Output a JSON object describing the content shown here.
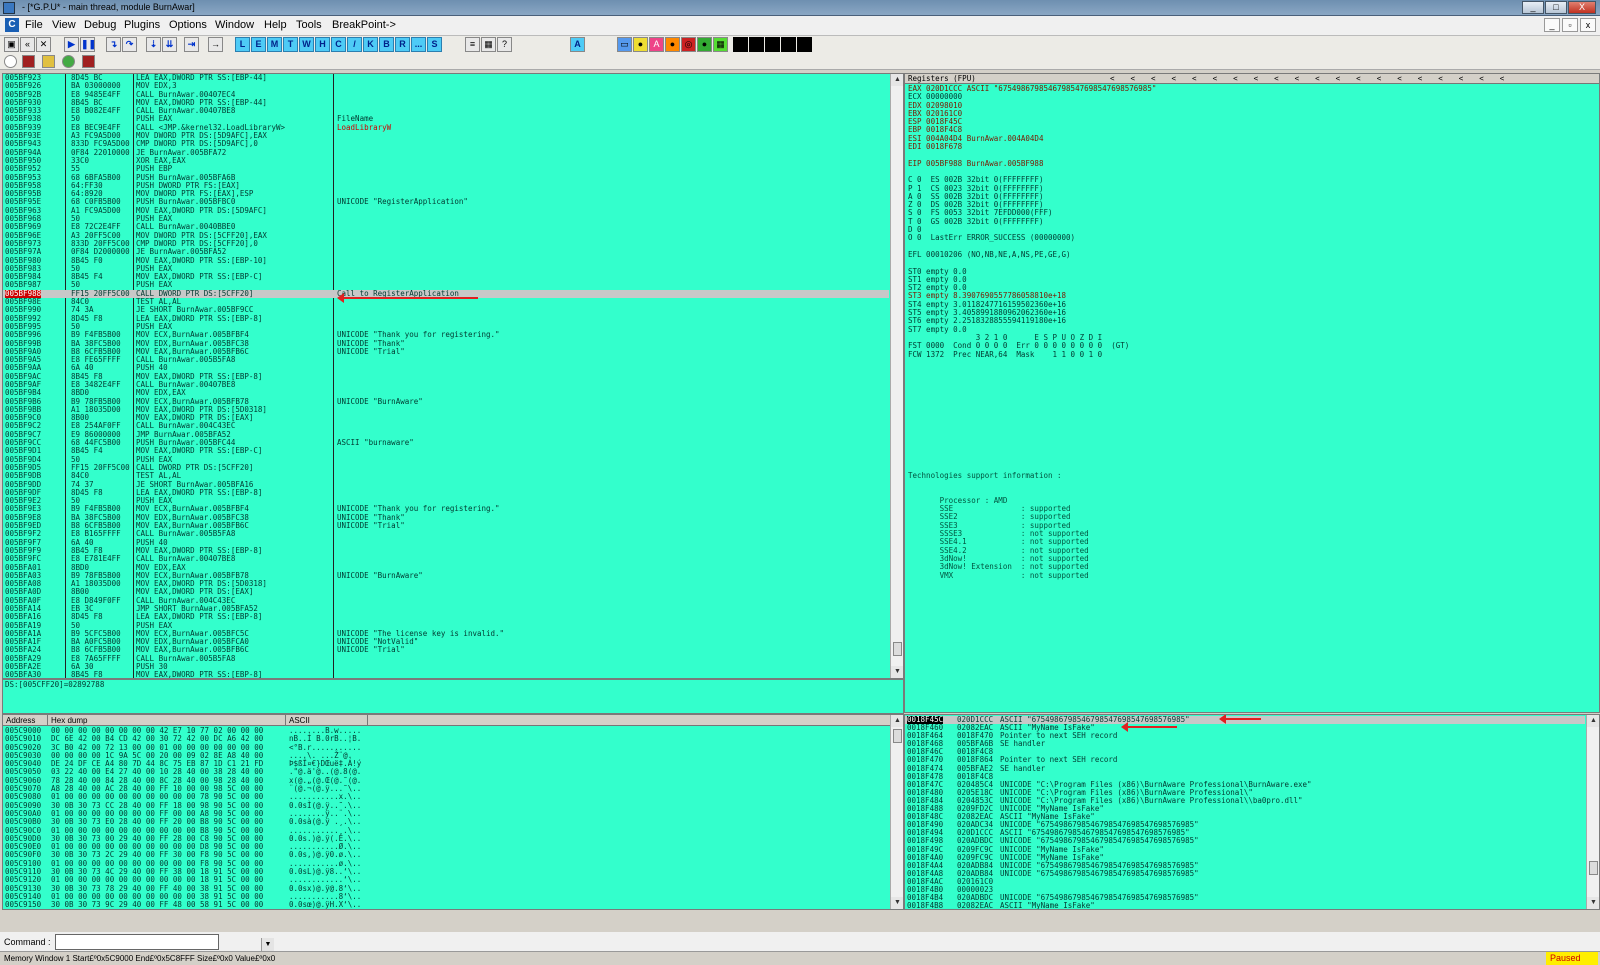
{
  "window": {
    "title": "- [*G.P.U* - main thread, module BurnAwar]",
    "controls": [
      "_",
      "□",
      "X"
    ]
  },
  "menu": {
    "items": [
      "File",
      "View",
      "Debug",
      "Plugins",
      "Options",
      "Window",
      "Help",
      "Tools",
      "BreakPoint->"
    ]
  },
  "toolbar": {
    "letters": [
      "L",
      "E",
      "M",
      "T",
      "W",
      "H",
      "C",
      "/",
      "K",
      "B",
      "R",
      "...",
      "S"
    ]
  },
  "cpu": {
    "rows": [
      {
        "addr": "005BF923",
        "hex": "8D45 BC",
        "asm": "LEA EAX,DWORD PTR SS:[EBP-44]",
        "cmt": ""
      },
      {
        "addr": "005BF926",
        "hex": "BA 03000000",
        "asm": "MOV EDX,3",
        "cmt": ""
      },
      {
        "addr": "005BF92B",
        "hex": "E8 9485E4FF",
        "asm": "CALL BurnAwar.00407EC4",
        "cmt": ""
      },
      {
        "addr": "005BF930",
        "hex": "8B45 BC",
        "asm": "MOV EAX,DWORD PTR SS:[EBP-44]",
        "cmt": ""
      },
      {
        "addr": "005BF933",
        "hex": "E8 B082E4FF",
        "asm": "CALL BurnAwar.00407BE8",
        "cmt": ""
      },
      {
        "addr": "005BF938",
        "hex": "50",
        "asm": "PUSH EAX",
        "cmt": "FileName"
      },
      {
        "addr": "005BF939",
        "hex": "E8 BEC9E4FF",
        "asm": "CALL <JMP.&kernel32.LoadLibraryW>",
        "cmt": "LoadLibraryW"
      },
      {
        "addr": "005BF93E",
        "hex": "A3 FC9A5D00",
        "asm": "MOV DWORD PTR DS:[5D9AFC],EAX",
        "cmt": ""
      },
      {
        "addr": "005BF943",
        "hex": "833D FC9A5D00",
        "asm": "CMP DWORD PTR DS:[5D9AFC],0",
        "cmt": ""
      },
      {
        "addr": "005BF94A",
        "hex": "0F84 22010000",
        "asm": "JE BurnAwar.005BFA72",
        "cmt": ""
      },
      {
        "addr": "005BF950",
        "hex": "33C0",
        "asm": "XOR EAX,EAX",
        "cmt": ""
      },
      {
        "addr": "005BF952",
        "hex": "55",
        "asm": "PUSH EBP",
        "cmt": ""
      },
      {
        "addr": "005BF953",
        "hex": "68 6BFA5B00",
        "asm": "PUSH BurnAwar.005BFA6B",
        "cmt": ""
      },
      {
        "addr": "005BF958",
        "hex": "64:FF30",
        "asm": "PUSH DWORD PTR FS:[EAX]",
        "cmt": ""
      },
      {
        "addr": "005BF95B",
        "hex": "64:8920",
        "asm": "MOV DWORD PTR FS:[EAX],ESP",
        "cmt": ""
      },
      {
        "addr": "005BF95E",
        "hex": "68 C0FB5B00",
        "asm": "PUSH BurnAwar.005BFBC0",
        "cmt": "UNICODE \"RegisterApplication\""
      },
      {
        "addr": "005BF963",
        "hex": "A1 FC9A5D00",
        "asm": "MOV EAX,DWORD PTR DS:[5D9AFC]",
        "cmt": ""
      },
      {
        "addr": "005BF968",
        "hex": "50",
        "asm": "PUSH EAX",
        "cmt": ""
      },
      {
        "addr": "005BF969",
        "hex": "E8 72C2E4FF",
        "asm": "CALL BurnAwar.0040BBE0",
        "cmt": ""
      },
      {
        "addr": "005BF96E",
        "hex": "A3 20FF5C00",
        "asm": "MOV DWORD PTR DS:[5CFF20],EAX",
        "cmt": ""
      },
      {
        "addr": "005BF973",
        "hex": "833D 20FF5C00",
        "asm": "CMP DWORD PTR DS:[5CFF20],0",
        "cmt": ""
      },
      {
        "addr": "005BF97A",
        "hex": "0F84 D2000000",
        "asm": "JE BurnAwar.005BFA52",
        "cmt": ""
      },
      {
        "addr": "005BF980",
        "hex": "8B45 F0",
        "asm": "MOV EAX,DWORD PTR SS:[EBP-10]",
        "cmt": ""
      },
      {
        "addr": "005BF983",
        "hex": "50",
        "asm": "PUSH EAX",
        "cmt": ""
      },
      {
        "addr": "005BF984",
        "hex": "8B45 F4",
        "asm": "MOV EAX,DWORD PTR SS:[EBP-C]",
        "cmt": ""
      },
      {
        "addr": "005BF987",
        "hex": "50",
        "asm": "PUSH EAX",
        "cmt": ""
      },
      {
        "addr": "005BF988",
        "hex": "FF15 20FF5C00",
        "asm": "CALL DWORD PTR DS:[5CFF20]",
        "cmt": "Call to RegisterApplication"
      },
      {
        "addr": "005BF98E",
        "hex": "84C0",
        "asm": "TEST AL,AL",
        "cmt": ""
      },
      {
        "addr": "005BF990",
        "hex": "74 3A",
        "asm": "JE SHORT BurnAwar.005BF9CC",
        "cmt": ""
      },
      {
        "addr": "005BF992",
        "hex": "8D45 F8",
        "asm": "LEA EAX,DWORD PTR SS:[EBP-8]",
        "cmt": ""
      },
      {
        "addr": "005BF995",
        "hex": "50",
        "asm": "PUSH EAX",
        "cmt": ""
      },
      {
        "addr": "005BF996",
        "hex": "B9 F4FB5B00",
        "asm": "MOV ECX,BurnAwar.005BFBF4",
        "cmt": "UNICODE \"Thank you for registering.\""
      },
      {
        "addr": "005BF99B",
        "hex": "BA 38FC5B00",
        "asm": "MOV EDX,BurnAwar.005BFC38",
        "cmt": "UNICODE \"Thank\""
      },
      {
        "addr": "005BF9A0",
        "hex": "B8 6CFB5B00",
        "asm": "MOV EAX,BurnAwar.005BFB6C",
        "cmt": "UNICODE \"Trial\""
      },
      {
        "addr": "005BF9A5",
        "hex": "E8 FE65FFFF",
        "asm": "CALL BurnAwar.005B5FA8",
        "cmt": ""
      },
      {
        "addr": "005BF9AA",
        "hex": "6A 40",
        "asm": "PUSH 40",
        "cmt": ""
      },
      {
        "addr": "005BF9AC",
        "hex": "8B45 F8",
        "asm": "MOV EAX,DWORD PTR SS:[EBP-8]",
        "cmt": ""
      },
      {
        "addr": "005BF9AF",
        "hex": "E8 3482E4FF",
        "asm": "CALL BurnAwar.00407BE8",
        "cmt": ""
      },
      {
        "addr": "005BF9B4",
        "hex": "8BD0",
        "asm": "MOV EDX,EAX",
        "cmt": ""
      },
      {
        "addr": "005BF9B6",
        "hex": "B9 78FB5B00",
        "asm": "MOV ECX,BurnAwar.005BFB78",
        "cmt": "UNICODE \"BurnAware\""
      },
      {
        "addr": "005BF9BB",
        "hex": "A1 18035D00",
        "asm": "MOV EAX,DWORD PTR DS:[5D0318]",
        "cmt": ""
      },
      {
        "addr": "005BF9C0",
        "hex": "8B00",
        "asm": "MOV EAX,DWORD PTR DS:[EAX]",
        "cmt": ""
      },
      {
        "addr": "005BF9C2",
        "hex": "E8 254AF0FF",
        "asm": "CALL BurnAwar.004C43EC",
        "cmt": ""
      },
      {
        "addr": "005BF9C7",
        "hex": "E9 86000000",
        "asm": "JMP BurnAwar.005BFA52",
        "cmt": ""
      },
      {
        "addr": "005BF9CC",
        "hex": "68 44FC5B00",
        "asm": "PUSH BurnAwar.005BFC44",
        "cmt": "ASCII \"burnaware\""
      },
      {
        "addr": "005BF9D1",
        "hex": "8B45 F4",
        "asm": "MOV EAX,DWORD PTR SS:[EBP-C]",
        "cmt": ""
      },
      {
        "addr": "005BF9D4",
        "hex": "50",
        "asm": "PUSH EAX",
        "cmt": ""
      },
      {
        "addr": "005BF9D5",
        "hex": "FF15 20FF5C00",
        "asm": "CALL DWORD PTR DS:[5CFF20]",
        "cmt": ""
      },
      {
        "addr": "005BF9DB",
        "hex": "84C0",
        "asm": "TEST AL,AL",
        "cmt": ""
      },
      {
        "addr": "005BF9DD",
        "hex": "74 37",
        "asm": "JE SHORT BurnAwar.005BFA16",
        "cmt": ""
      },
      {
        "addr": "005BF9DF",
        "hex": "8D45 F8",
        "asm": "LEA EAX,DWORD PTR SS:[EBP-8]",
        "cmt": ""
      },
      {
        "addr": "005BF9E2",
        "hex": "50",
        "asm": "PUSH EAX",
        "cmt": ""
      },
      {
        "addr": "005BF9E3",
        "hex": "B9 F4FB5B00",
        "asm": "MOV ECX,BurnAwar.005BFBF4",
        "cmt": "UNICODE \"Thank you for registering.\""
      },
      {
        "addr": "005BF9E8",
        "hex": "BA 38FC5B00",
        "asm": "MOV EDX,BurnAwar.005BFC38",
        "cmt": "UNICODE \"Thank\""
      },
      {
        "addr": "005BF9ED",
        "hex": "B8 6CFB5B00",
        "asm": "MOV EAX,BurnAwar.005BFB6C",
        "cmt": "UNICODE \"Trial\""
      },
      {
        "addr": "005BF9F2",
        "hex": "E8 B165FFFF",
        "asm": "CALL BurnAwar.005B5FA8",
        "cmt": ""
      },
      {
        "addr": "005BF9F7",
        "hex": "6A 40",
        "asm": "PUSH 40",
        "cmt": ""
      },
      {
        "addr": "005BF9F9",
        "hex": "8B45 F8",
        "asm": "MOV EAX,DWORD PTR SS:[EBP-8]",
        "cmt": ""
      },
      {
        "addr": "005BF9FC",
        "hex": "E8 E781E4FF",
        "asm": "CALL BurnAwar.00407BE8",
        "cmt": ""
      },
      {
        "addr": "005BFA01",
        "hex": "8BD0",
        "asm": "MOV EDX,EAX",
        "cmt": ""
      },
      {
        "addr": "005BFA03",
        "hex": "B9 78FB5B00",
        "asm": "MOV ECX,BurnAwar.005BFB78",
        "cmt": "UNICODE \"BurnAware\""
      },
      {
        "addr": "005BFA08",
        "hex": "A1 18035D00",
        "asm": "MOV EAX,DWORD PTR DS:[5D0318]",
        "cmt": ""
      },
      {
        "addr": "005BFA0D",
        "hex": "8B00",
        "asm": "MOV EAX,DWORD PTR DS:[EAX]",
        "cmt": ""
      },
      {
        "addr": "005BFA0F",
        "hex": "E8 D849F0FF",
        "asm": "CALL BurnAwar.004C43EC",
        "cmt": ""
      },
      {
        "addr": "005BFA14",
        "hex": "EB 3C",
        "asm": "JMP SHORT BurnAwar.005BFA52",
        "cmt": ""
      },
      {
        "addr": "005BFA16",
        "hex": "8D45 F8",
        "asm": "LEA EAX,DWORD PTR SS:[EBP-8]",
        "cmt": ""
      },
      {
        "addr": "005BFA19",
        "hex": "50",
        "asm": "PUSH EAX",
        "cmt": ""
      },
      {
        "addr": "005BFA1A",
        "hex": "B9 5CFC5B00",
        "asm": "MOV ECX,BurnAwar.005BFC5C",
        "cmt": "UNICODE \"The license key is invalid.\""
      },
      {
        "addr": "005BFA1F",
        "hex": "BA A0FC5B00",
        "asm": "MOV EDX,BurnAwar.005BFCA0",
        "cmt": "UNICODE \"NotValid\""
      },
      {
        "addr": "005BFA24",
        "hex": "B8 6CFB5B00",
        "asm": "MOV EAX,BurnAwar.005BFB6C",
        "cmt": "UNICODE \"Trial\""
      },
      {
        "addr": "005BFA29",
        "hex": "E8 7A65FFFF",
        "asm": "CALL BurnAwar.005B5FA8",
        "cmt": ""
      },
      {
        "addr": "005BFA2E",
        "hex": "6A 30",
        "asm": "PUSH 30",
        "cmt": ""
      },
      {
        "addr": "005BFA30",
        "hex": "8B45 F8",
        "asm": "MOV EAX,DWORD PTR SS:[EBP-8]",
        "cmt": ""
      },
      {
        "addr": "005BFA33",
        "hex": "E8 B081E4FF",
        "asm": "CALL BurnAwar.00407BE8",
        "cmt": ""
      }
    ],
    "selected_index": 26,
    "info_line": "DS:[005CFF20]=02892788"
  },
  "registers": {
    "header": "Registers (FPU)",
    "lines": [
      "EAX 020D1CCC ASCII \"6754986798546798547698547698576985\"",
      "ECX 00000000",
      "EDX 02098010",
      "EBX 020161C0",
      "ESP 0018F45C",
      "EBP 0018F4C8",
      "ESI 004A04D4 BurnAwar.004A04D4",
      "EDI 0018F678",
      "",
      "EIP 005BF988 BurnAwar.005BF988",
      "",
      "C 0  ES 002B 32bit 0(FFFFFFFF)",
      "P 1  CS 0023 32bit 0(FFFFFFFF)",
      "A 0  SS 002B 32bit 0(FFFFFFFF)",
      "Z 0  DS 002B 32bit 0(FFFFFFFF)",
      "S 0  FS 0053 32bit 7EFDD000(FFF)",
      "T 0  GS 002B 32bit 0(FFFFFFFF)",
      "D 0",
      "O 0  LastErr ERROR_SUCCESS (00000000)",
      "",
      "EFL 00010206 (NO,NB,NE,A,NS,PE,GE,G)",
      "",
      "ST0 empty 0.0",
      "ST1 empty 0.0",
      "ST2 empty 0.0",
      "ST3 empty 8.3907690557786058810e+18",
      "ST4 empty 3.0118247716159502360e+16",
      "ST5 empty 3.4058991880962062360e+16",
      "ST6 empty 2.2518328855594119180e+16",
      "ST7 empty 0.0",
      "               3 2 1 0      E S P U O Z D I",
      "FST 0000  Cond 0 0 0 0  Err 0 0 0 0 0 0 0 0  (GT)",
      "FCW 1372  Prec NEAR,64  Mask    1 1 0 0 1 0"
    ],
    "tech_lines": [
      "Technologies support information :",
      "",
      "",
      "       Processor : AMD",
      "       SSE               : supported",
      "       SSE2              : supported",
      "       SSE3              : supported",
      "       SSSE3             : not supported",
      "       SSE4.1            : not supported",
      "       SSE4.2            : not supported",
      "       3dNow!            : not supported",
      "       3dNow! Extension  : not supported",
      "       VMX               : not supported"
    ]
  },
  "dump": {
    "headers": {
      "address": "Address",
      "hex": "Hex dump",
      "ascii": "ASCII"
    },
    "rows": [
      {
        "addr": "005C9000",
        "hex": "00 00 00 00 00 00 00 00 42 E7 10 77 02 00 00 00",
        "ascii": "........B.w....."
      },
      {
        "addr": "005C9010",
        "hex": "DC 6E 42 00 B4 CD 42 00 30 72 42 00 DC A6 42 00",
        "ascii": "nB..Í B.0rB..¦B."
      },
      {
        "addr": "005C9020",
        "hex": "3C B0 42 00 72 13 00 00 01 00 00 00 00 00 00 00",
        "ascii": "<°B.r..........."
      },
      {
        "addr": "005C9030",
        "hex": "00 00 00 00 1C 9A 5C 00 20 00 09 02 8E A8 40 00",
        "ascii": "....\\. ...Ž¨@."
      },
      {
        "addr": "005C9040",
        "hex": "DE 24 DF CE A4 80 7D 44 8C 75 EB 87 1D C1 21 FD",
        "ascii": "Þ$ßÎ¤€}DŒuë‡.Á!ý"
      },
      {
        "addr": "005C9050",
        "hex": "03 22 40 00 E4 27 40 00 10 28 40 00 38 28 40 00",
        "ascii": ".\"@.ä'@..(@.8(@."
      },
      {
        "addr": "005C9060",
        "hex": "78 28 40 00 84 28 40 00 8C 28 40 00 98 28 40 00",
        "ascii": "x(@.„(@.Œ(@.˜(@."
      },
      {
        "addr": "005C9070",
        "hex": "A8 28 40 00 AC 28 40 00 FF 10 00 00 98 5C 00 00",
        "ascii": "¨(@.¬(@.ÿ...˜\\.."
      },
      {
        "addr": "005C9080",
        "hex": "01 00 00 00 00 00 00 00 00 00 00 78 90 5C 00 00",
        "ascii": "...........x.\\.."
      },
      {
        "addr": "005C9090",
        "hex": "30 0B 30 73 CC 28 40 00 FF 18 00 98 90 5C 00 00",
        "ascii": "0.0sÌ(@.ÿ..˜.\\.."
      },
      {
        "addr": "005C90A0",
        "hex": "01 00 00 00 00 00 00 00 FF 00 00 A8 90 5C 00 00",
        "ascii": "........ÿ..¨.\\.."
      },
      {
        "addr": "005C90B0",
        "hex": "30 0B 30 73 E0 28 40 00 FF 20 00 B8 90 5C 00 00",
        "ascii": "0.0sà(@.ÿ .¸.\\.."
      },
      {
        "addr": "005C90C0",
        "hex": "01 00 00 00 00 00 00 00 00 00 00 B8 90 5C 00 00",
        "ascii": "...........¸.\\.."
      },
      {
        "addr": "005C90D0",
        "hex": "30 0B 30 73 00 29 40 00 FF 28 00 C8 90 5C 00 00",
        "ascii": "0.0s.)@.ÿ(.È.\\.."
      },
      {
        "addr": "005C90E0",
        "hex": "01 00 00 00 00 00 00 00 00 00 00 D8 90 5C 00 00",
        "ascii": "...........Ø.\\.."
      },
      {
        "addr": "005C90F0",
        "hex": "30 0B 30 73 2C 29 40 00 FF 30 00 F8 90 5C 00 00",
        "ascii": "0.0s,)@.ÿ0.ø.\\.."
      },
      {
        "addr": "005C9100",
        "hex": "01 00 00 00 00 00 00 00 00 00 00 F8 90 5C 00 00",
        "ascii": "...........ø.\\.."
      },
      {
        "addr": "005C9110",
        "hex": "30 0B 30 73 4C 29 40 00 FF 38 00 18 91 5C 00 00",
        "ascii": "0.0sL)@.ÿ8..‘\\.."
      },
      {
        "addr": "005C9120",
        "hex": "01 00 00 00 00 00 00 00 00 00 00 18 91 5C 00 00",
        "ascii": "............‘\\.."
      },
      {
        "addr": "005C9130",
        "hex": "30 0B 30 73 78 29 40 00 FF 40 00 38 91 5C 00 00",
        "ascii": "0.0sx)@.ÿ@.8‘\\.."
      },
      {
        "addr": "005C9140",
        "hex": "01 00 00 00 00 00 00 00 00 00 00 38 91 5C 00 00",
        "ascii": "...........8‘\\.."
      },
      {
        "addr": "005C9150",
        "hex": "30 0B 30 73 9C 29 40 00 FF 48 00 58 91 5C 00 00",
        "ascii": "0.0sœ)@.ÿH.X‘\\.."
      }
    ]
  },
  "stack": {
    "rows": [
      {
        "addr": "0018F45C",
        "val": "020D1CCC",
        "cmt": "ASCII \"6754986798546798547698547698576985\""
      },
      {
        "addr": "0018F460",
        "val": "02082EAC",
        "cmt": "ASCII \"MyName IsFake\""
      },
      {
        "addr": "0018F464",
        "val": "0018F470",
        "cmt": "Pointer to next SEH record"
      },
      {
        "addr": "0018F468",
        "val": "005BFA6B",
        "cmt": "SE handler"
      },
      {
        "addr": "0018F46C",
        "val": "0018F4C8",
        "cmt": ""
      },
      {
        "addr": "0018F470",
        "val": "0018F864",
        "cmt": "Pointer to next SEH record"
      },
      {
        "addr": "0018F474",
        "val": "005BFAE2",
        "cmt": "SE handler"
      },
      {
        "addr": "0018F478",
        "val": "0018F4C8",
        "cmt": ""
      },
      {
        "addr": "0018F47C",
        "val": "020485C4",
        "cmt": "UNICODE \"C:\\Program Files (x86)\\BurnAware Professional\\BurnAware.exe\""
      },
      {
        "addr": "0018F480",
        "val": "0205E18C",
        "cmt": "UNICODE \"C:\\Program Files (x86)\\BurnAware Professional\\\""
      },
      {
        "addr": "0018F484",
        "val": "0204853C",
        "cmt": "UNICODE \"C:\\Program Files (x86)\\BurnAware Professional\\\\ba0pro.dll\""
      },
      {
        "addr": "0018F488",
        "val": "0209FD2C",
        "cmt": "UNICODE \"MyName IsFake\""
      },
      {
        "addr": "0018F48C",
        "val": "02082EAC",
        "cmt": "ASCII \"MyName IsFake\""
      },
      {
        "addr": "0018F490",
        "val": "020ADC34",
        "cmt": "UNICODE \"6754986798546798547698547698576985\""
      },
      {
        "addr": "0018F494",
        "val": "020D1CCC",
        "cmt": "ASCII \"6754986798546798547698547698576985\""
      },
      {
        "addr": "0018F498",
        "val": "020ADBDC",
        "cmt": "UNICODE \"6754986798546798547698547698576985\""
      },
      {
        "addr": "0018F49C",
        "val": "0209FC9C",
        "cmt": "UNICODE \"MyName IsFake\""
      },
      {
        "addr": "0018F4A0",
        "val": "0209FC9C",
        "cmt": "UNICODE \"MyName IsFake\""
      },
      {
        "addr": "0018F4A4",
        "val": "020ADB84",
        "cmt": "UNICODE \"6754986798546798547698547698576985\""
      },
      {
        "addr": "0018F4A8",
        "val": "020ADB84",
        "cmt": "UNICODE \"6754986798546798547698547698576985\""
      },
      {
        "addr": "0018F4AC",
        "val": "020161C0",
        "cmt": ""
      },
      {
        "addr": "0018F4B0",
        "val": "00000023",
        "cmt": ""
      },
      {
        "addr": "0018F4B4",
        "val": "020ADBDC",
        "cmt": "UNICODE \"6754986798546798547698547698576985\""
      },
      {
        "addr": "0018F4B8",
        "val": "02082EAC",
        "cmt": "ASCII \"MyName IsFake\""
      }
    ]
  },
  "command": {
    "label": "Command :",
    "value": ""
  },
  "status": {
    "text": "Memory Window 1  Start£º0x5C9000  End£º0x5C8FFF  Size£º0x0 Value£º0x0",
    "state": "Paused"
  },
  "colors": {
    "pane_bg": "#33ffcc",
    "accent_red": "#e02020",
    "paused_bg": "#ffee00"
  }
}
